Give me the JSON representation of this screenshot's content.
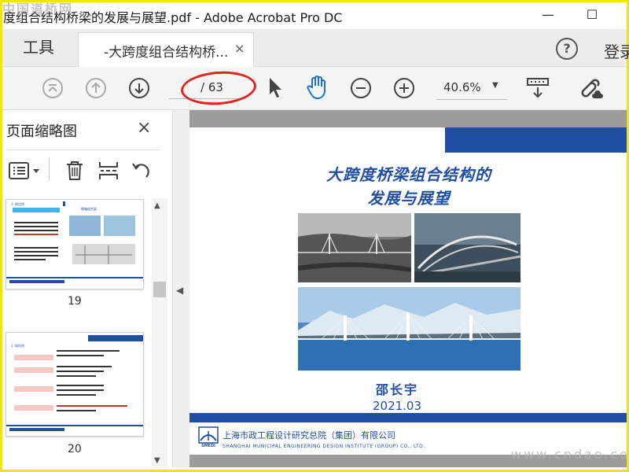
{
  "window": {
    "title": "度组合结构桥梁的发展与展望.pdf - Adobe Acrobat Pro DC",
    "watermark_top": "中国道桥网",
    "minimize_glyph": "—",
    "maximize_glyph": "☐"
  },
  "tabs": {
    "tools_label": "工具",
    "doc_label": "-大跨度组合结构桥...",
    "doc_close": "×"
  },
  "header": {
    "help_glyph": "?",
    "signin_label": "登录"
  },
  "toolbar": {
    "page_display": "/ 63",
    "zoom_value": "40.6%",
    "icons": [
      "first-page-icon",
      "prev-page-icon",
      "next-page-icon",
      "pointer-icon",
      "hand-icon",
      "zoom-out-icon",
      "zoom-in-icon",
      "scroll-mode-icon",
      "link-icon"
    ]
  },
  "sidepanel": {
    "title": "页面缩略图",
    "close_glyph": "×",
    "thumbnails": [
      {
        "page_label": "19"
      },
      {
        "page_label": "20"
      }
    ]
  },
  "slide": {
    "title_line1": "大跨度桥梁组合结构的",
    "title_line2": "发展与展望",
    "author": "邵长宇",
    "date": "2021.03",
    "org_name": "上海市政工程设计研究总院（集团）有限公司",
    "org_name_en": "SHANGHAI MUNICIPAL ENGINEERING DESIGN INSTITUTE (GROUP) CO., LTD.",
    "logo_text": "SMEDI"
  },
  "watermark_bottom": "www.cndao.com",
  "colors": {
    "accent_blue": "#1f4ea3",
    "annotation_red": "#e0261e",
    "frame_yellow": "#f2e600"
  }
}
